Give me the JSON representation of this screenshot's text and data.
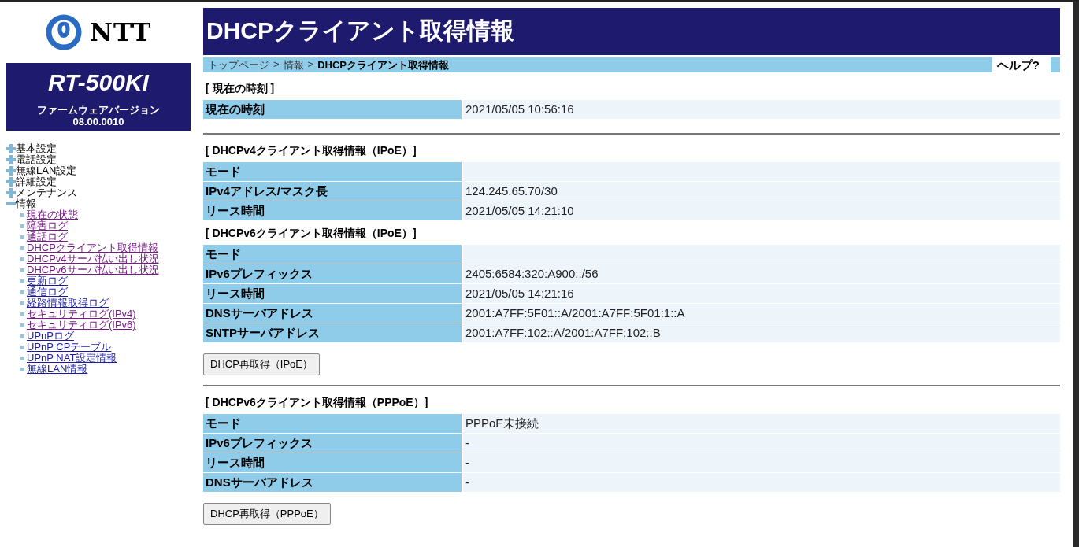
{
  "sidebar": {
    "logo_text": "NTT",
    "model": "RT-500KI",
    "firmware_label": "ファームウェアバージョン",
    "firmware_version": "08.00.0010",
    "menu": [
      {
        "label": "基本設定",
        "expanded": false
      },
      {
        "label": "電話設定",
        "expanded": false
      },
      {
        "label": "無線LAN設定",
        "expanded": false
      },
      {
        "label": "詳細設定",
        "expanded": false
      },
      {
        "label": "メンテナンス",
        "expanded": false
      },
      {
        "label": "情報",
        "expanded": true,
        "children": [
          {
            "label": "現在の状態",
            "visited": true
          },
          {
            "label": "障害ログ",
            "visited": true
          },
          {
            "label": "通話ログ",
            "visited": true
          },
          {
            "label": "DHCPクライアント取得情報",
            "visited": true
          },
          {
            "label": "DHCPv4サーバ払い出し状況",
            "visited": true
          },
          {
            "label": "DHCPv6サーバ払い出し状況",
            "visited": true
          },
          {
            "label": "更新ログ",
            "visited": false
          },
          {
            "label": "通信ログ",
            "visited": false
          },
          {
            "label": "経路情報取得ログ",
            "visited": false
          },
          {
            "label": "セキュリティログ(IPv4)",
            "visited": true
          },
          {
            "label": "セキュリティログ(IPv6)",
            "visited": true
          },
          {
            "label": "UPnPログ",
            "visited": false
          },
          {
            "label": "UPnP CPテーブル",
            "visited": false
          },
          {
            "label": "UPnP NAT設定情報",
            "visited": false
          },
          {
            "label": "無線LAN情報",
            "visited": false
          }
        ]
      }
    ]
  },
  "page_title": "DHCPクライアント取得情報",
  "breadcrumb": [
    {
      "label": "トップページ",
      "current": false
    },
    {
      "label": "情報",
      "current": false
    },
    {
      "label": "DHCPクライアント取得情報",
      "current": true
    }
  ],
  "breadcrumb_separator": ">",
  "help": "ヘルプ?",
  "groups": [
    {
      "sections": [
        {
          "heading": "[ 現在の時刻 ]",
          "rows": [
            {
              "label": "現在の時刻",
              "value": "2021/05/05 10:56:16"
            }
          ]
        }
      ]
    },
    {
      "sections": [
        {
          "heading": "[ DHCPv4クライアント取得情報（IPoE）]",
          "rows": [
            {
              "label": "モード",
              "value": ""
            },
            {
              "label": "IPv4アドレス/マスク長",
              "value": "124.245.65.70/30"
            },
            {
              "label": "リース時間",
              "value": "2021/05/05 14:21:10"
            }
          ]
        },
        {
          "heading": "[ DHCPv6クライアント取得情報（IPoE）]",
          "rows": [
            {
              "label": "モード",
              "value": ""
            },
            {
              "label": "IPv6プレフィックス",
              "value": "2405:6584:320:A900::/56"
            },
            {
              "label": "リース時間",
              "value": "2021/05/05 14:21:16"
            },
            {
              "label": "DNSサーバアドレス",
              "value": "2001:A7FF:5F01::A/2001:A7FF:5F01:1::A"
            },
            {
              "label": "SNTPサーバアドレス",
              "value": "2001:A7FF:102::A/2001:A7FF:102::B"
            }
          ]
        }
      ],
      "button": "DHCP再取得（IPoE）"
    },
    {
      "sections": [
        {
          "heading": "[ DHCPv6クライアント取得情報（PPPoE）]",
          "rows": [
            {
              "label": "モード",
              "value": "PPPoE未接続"
            },
            {
              "label": "IPv6プレフィックス",
              "value": "-"
            },
            {
              "label": "リース時間",
              "value": "-"
            },
            {
              "label": "DNSサーバアドレス",
              "value": "-"
            }
          ]
        }
      ],
      "button": "DHCP再取得（PPPoE）"
    }
  ]
}
